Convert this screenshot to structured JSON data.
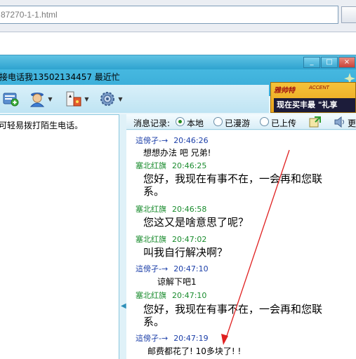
{
  "browser": {
    "address_text": "87270-1-1.html"
  },
  "window": {
    "title": "接电话我13502134457  最近忙",
    "controls": {
      "minimize": "_",
      "maximize": "□",
      "close": "×"
    }
  },
  "toolbar": {
    "buttons": [
      {
        "name": "send-file",
        "icon": "file-add-icon"
      },
      {
        "name": "video",
        "icon": "user-video-icon"
      },
      {
        "name": "apps",
        "icon": "apps-icon"
      },
      {
        "name": "settings",
        "icon": "gear-icon"
      }
    ]
  },
  "ad": {
    "brand": "雅帅特",
    "sub": "ACCENT",
    "slogan": "现在买丰最 \"礼享"
  },
  "left_panel": {
    "text": "可轻易拨打陌生电话。"
  },
  "history": {
    "label": "消息记录:",
    "options": [
      {
        "label": "本地",
        "selected": true
      },
      {
        "label": "已漫游",
        "selected": false
      },
      {
        "label": "已上传",
        "selected": false
      }
    ],
    "more_label": "更"
  },
  "messages": [
    {
      "sender": "這傍孑-→",
      "time": "20:46:26",
      "color": "blue",
      "text": "想想办法 吧  兄弟!",
      "size": "small"
    },
    {
      "sender": "塞北红旗",
      "time": "20:46:25",
      "color": "green",
      "text": "您好，我现在有事不在，一会再和您联",
      "text2": "系。",
      "size": "large"
    },
    {
      "sender": "塞北红旗",
      "time": "20:46:58",
      "color": "green",
      "text": "您这又是啥意思了呢？",
      "size": "large"
    },
    {
      "sender": "塞北红旗",
      "time": "20:47:02",
      "color": "green",
      "text": "叫我自行解决啊？",
      "size": "large"
    },
    {
      "sender": "這傍孑-→",
      "time": "20:47:10",
      "color": "blue",
      "text": "谅解下吧1",
      "size": "small"
    },
    {
      "sender": "塞北红旗",
      "time": "20:47:10",
      "color": "green",
      "text": "您好，我现在有事不在，一会再和您联",
      "text2": "系。",
      "size": "large"
    },
    {
      "sender": "這傍孑-→",
      "time": "20:47:19",
      "color": "blue",
      "text": "邮费都花了! 10多块了! !",
      "size": "small"
    }
  ],
  "colors": {
    "header_blue": "#36aad6",
    "sender_blue": "#1c3fa8",
    "sender_green": "#1a8c2e",
    "annotation_red": "#e02020"
  }
}
